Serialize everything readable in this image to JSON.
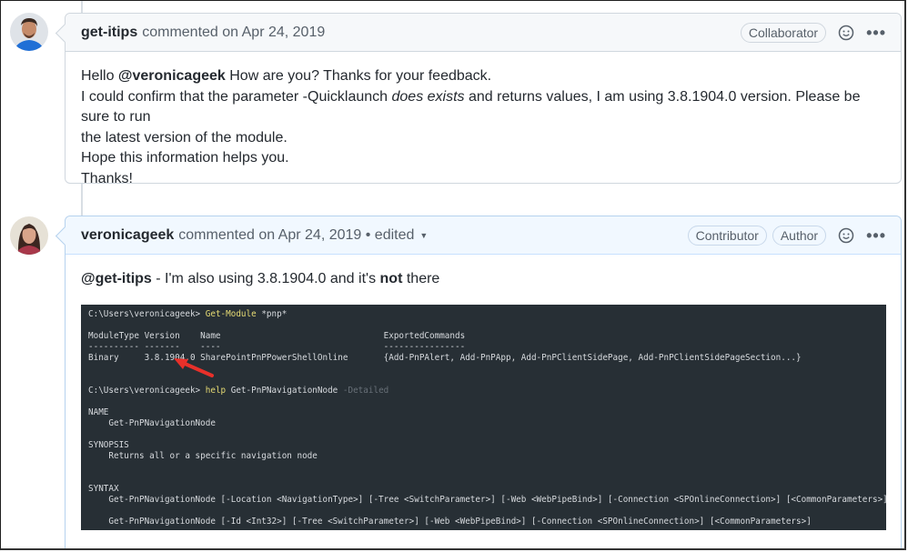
{
  "comments": [
    {
      "author": "get-itips",
      "meta": "commented on Apr 24, 2019",
      "badges": [
        "Collaborator"
      ],
      "avatar_icon": "avatar-man-blue-shirt",
      "body": {
        "line1_prefix": "Hello ",
        "line1_mention": "@veronicageek",
        "line1_suffix": " How are you? Thanks for your feedback.",
        "line2_prefix": "I could confirm that the parameter -Quicklaunch ",
        "line2_italic": "does exists",
        "line2_suffix": " and returns values, I am using 3.8.1904.0 version. Please be sure to run",
        "line3": "the latest version of the module.",
        "line4": "Hope this information helps you.",
        "line5": "Thanks!"
      }
    },
    {
      "author": "veronicageek",
      "meta": "commented on Apr 24, 2019 • edited",
      "badges": [
        "Contributor",
        "Author"
      ],
      "avatar_icon": "avatar-woman",
      "body": {
        "mention": "@get-itips",
        "text_prefix": " - I'm also using 3.8.1904.0 and it's ",
        "text_bold": "not",
        "text_suffix": " there"
      },
      "terminal": {
        "prompt1": "C:\\Users\\veronicageek> ",
        "cmd1": "Get-Module",
        "arg1": " *pnp*",
        "header": "ModuleType Version    Name                                ExportedCommands",
        "rule": "---------- -------    ----                                ----------------",
        "row": "Binary     3.8.1904.0 SharePointPnPPowerShellOnline       {Add-PnPAlert, Add-PnPApp, Add-PnPClientSidePage, Add-PnPClientSidePageSection...}",
        "prompt2": "C:\\Users\\veronicageek> ",
        "cmd2": "help",
        "arg2": " Get-PnPNavigationNode ",
        "flag2": "-Detailed",
        "name_label": "NAME",
        "name_value": "    Get-PnPNavigationNode",
        "synopsis_label": "SYNOPSIS",
        "synopsis_value": "    Returns all or a specific navigation node",
        "syntax_label": "SYNTAX",
        "syntax1": "    Get-PnPNavigationNode [-Location <NavigationType>] [-Tree <SwitchParameter>] [-Web <WebPipeBind>] [-Connection <SPOnlineConnection>] [<CommonParameters>]",
        "syntax2": "    Get-PnPNavigationNode [-Id <Int32>] [-Tree <SwitchParameter>] [-Web <WebPipeBind>] [-Connection <SPOnlineConnection>] [<CommonParameters>]"
      }
    }
  ],
  "icons": {
    "emoji": "smiley-icon",
    "more": "kebab-horizontal-icon",
    "edited_dropdown": "triangle-down-icon",
    "annotation": "red-arrow-icon"
  },
  "colors": {
    "terminal_bg": "#272f35",
    "highlight_yellow": "#e6db74",
    "arrow_red": "#e8302a",
    "author_header_bg": "#f1f8ff"
  }
}
